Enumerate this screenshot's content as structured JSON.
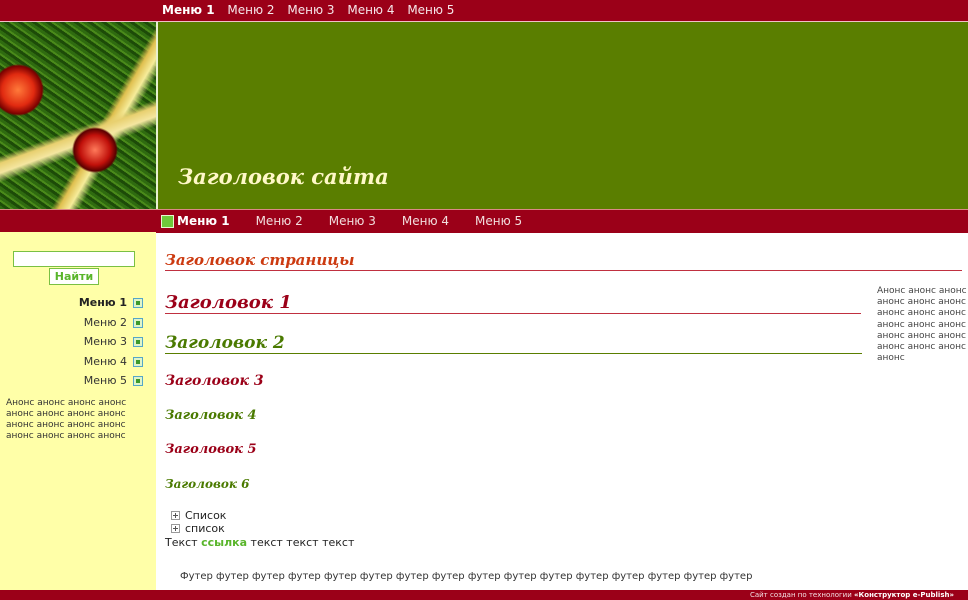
{
  "top_menu": {
    "items": [
      "Меню 1",
      "Меню 2",
      "Меню 3",
      "Меню 4",
      "Меню 5"
    ]
  },
  "header": {
    "site_title": "Заголовок сайта",
    "photo_icon": "christmas-tree-photo"
  },
  "nav_menu": {
    "items": [
      "Меню 1",
      "Меню 2",
      "Меню 3",
      "Меню 4",
      "Меню 5"
    ]
  },
  "sidebar": {
    "search_button": "Найти",
    "search_value": "",
    "menu": [
      "Меню 1",
      "Меню 2",
      "Меню 3",
      "Меню 4",
      "Меню 5"
    ],
    "anons": "Анонс анонс анонс анонс анонс анонс анонс анонс анонс анонс анонс анонс анонс анонс анонс анонс"
  },
  "main": {
    "page_title": "Заголовок страницы",
    "h1": "Заголовок 1",
    "h2": "Заголовок 2",
    "h3": "Заголовок 3",
    "h4": "Заголовок 4",
    "h5": "Заголовок 5",
    "h6": "Заголовок 6",
    "list": [
      "Список",
      "список"
    ],
    "text_before": "Текст",
    "link": "ссылка",
    "text_after": "текст текст текст",
    "footer_text": "Футер футер футер футер футер футер футер футер футер футер футер футер футер футер футер футер"
  },
  "right": {
    "anons": "Анонс анонс анонс анонс анонс анонс анонс анонс анонс анонс анонс анонс анонс анонс анонс анонс анонс анонс анонс"
  },
  "footer": {
    "credit_prefix": "Сайт создан по технологии",
    "credit_brand": "«Конструктор e-Publish»"
  },
  "colors": {
    "bar": "#9b0018",
    "header_green": "#5a7e00",
    "sidebar": "#ffffa8",
    "link_green": "#59b52b"
  }
}
